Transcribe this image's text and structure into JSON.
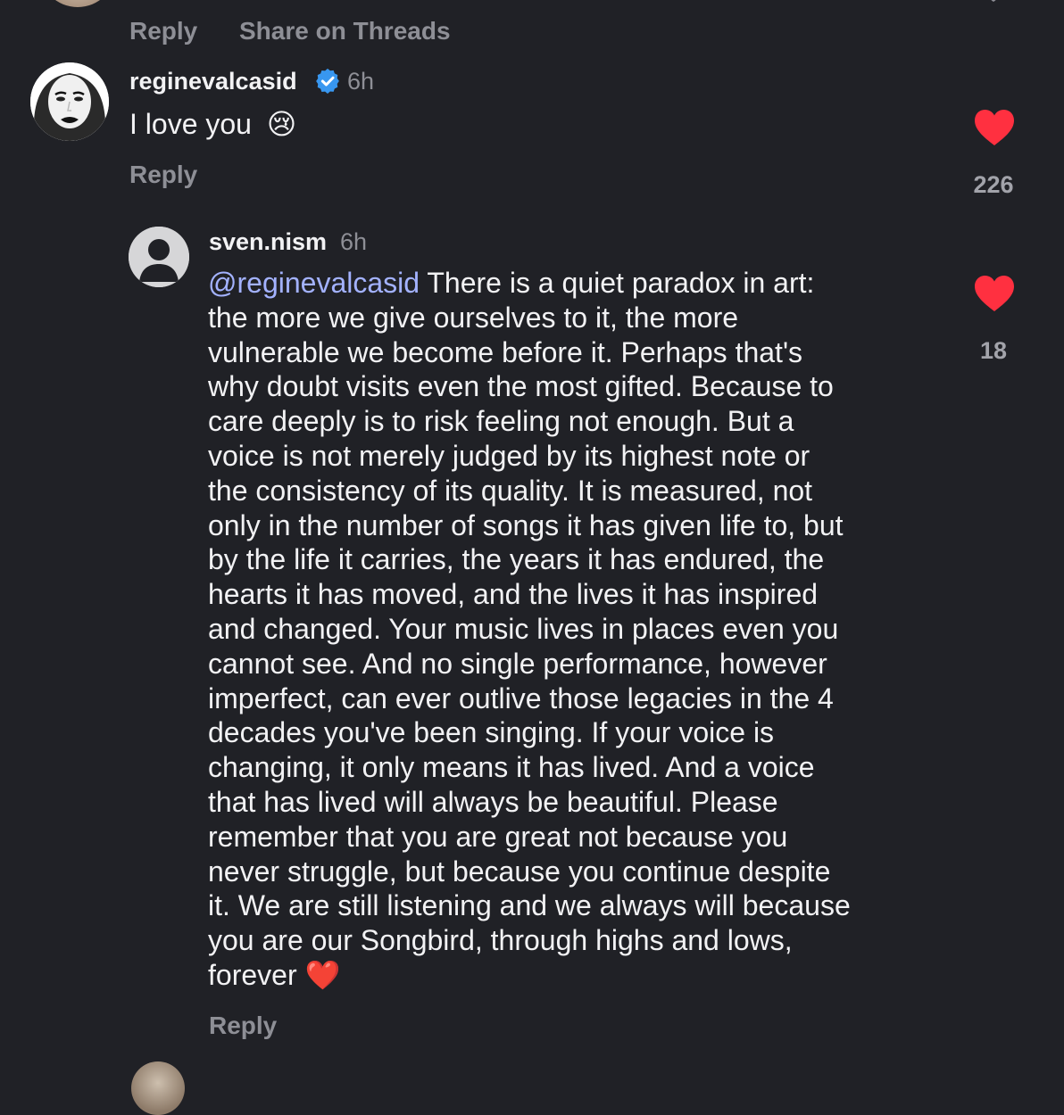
{
  "top_actions": {
    "reply_label": "Reply",
    "share_label": "Share on Threads"
  },
  "comments": [
    {
      "username": "reginevalcasid",
      "verified": true,
      "time": "6h",
      "text": "I love you",
      "emoji": "😢",
      "reply_label": "Reply",
      "likes": "226",
      "liked": true
    },
    {
      "username": "sven.nism",
      "verified": false,
      "time": "6h",
      "mention": "@reginevalcasid",
      "text_lines": [
        "There is a quiet paradox in art:",
        "the more we give ourselves to it, the more",
        "vulnerable we become before it. Perhaps that's",
        "why doubt visits even the most gifted. Because to",
        "care deeply is to risk feeling not enough. But a",
        "voice is not merely judged by its highest note or",
        "the consistency of its quality. It is measured, not",
        "only in the number of songs it has given life to, but",
        "by the life it carries, the years it has endured, the",
        "hearts it has moved, and the lives it has inspired",
        "and changed. Your music lives in places even you",
        "cannot see. And no single performance, however",
        "imperfect, can ever outlive those legacies in the 4",
        "decades you've been singing. If your voice is",
        "changing, it only means it has lived. And a voice",
        "that has lived will always be beautiful. Please",
        "remember that you are great not because you",
        "never struggle, but because you continue despite",
        "it. We are still listening and we always will because",
        "you are our Songbird, through highs and lows,",
        "forever"
      ],
      "emoji": "❤️",
      "reply_label": "Reply",
      "likes": "18",
      "liked": true
    }
  ],
  "colors": {
    "background": "#202126",
    "text": "#f2f2f4",
    "muted": "#8e8f96",
    "mention": "#a3b2ff",
    "heart": "#ff3040",
    "verified": "#3897f0"
  },
  "icons": {
    "verified": "verified-badge-icon",
    "like": "heart-icon",
    "collapse": "chevron-icon"
  }
}
